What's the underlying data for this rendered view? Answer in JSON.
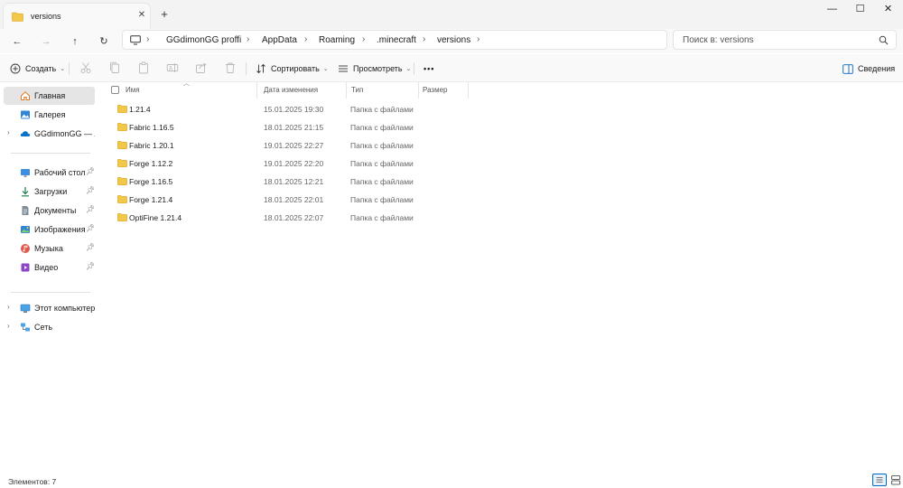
{
  "tab": {
    "title": "versions",
    "close": "✕",
    "new_tab": "+"
  },
  "window": {
    "minimize": "—",
    "maximize": "☐",
    "close": "✕"
  },
  "nav": {
    "back": "←",
    "forward": "→",
    "up": "↑",
    "refresh": "↻"
  },
  "breadcrumb": [
    "GGdimonGG proffi",
    "AppData",
    "Roaming",
    ".minecraft",
    "versions"
  ],
  "search": {
    "placeholder": "Поиск в: versions"
  },
  "toolbar": {
    "create": "Создать",
    "sort": "Сортировать",
    "view": "Просмотреть",
    "more": "•••",
    "details": "Сведения"
  },
  "sidebar": {
    "items": [
      {
        "label": "Главная",
        "icon": "home-icon"
      },
      {
        "label": "Галерея",
        "icon": "gallery-icon"
      },
      {
        "label": "GGdimonGG — Ли",
        "icon": "onedrive-icon"
      },
      {
        "label": "Рабочий стол",
        "icon": "desktop-icon"
      },
      {
        "label": "Загрузки",
        "icon": "downloads-icon"
      },
      {
        "label": "Документы",
        "icon": "documents-icon"
      },
      {
        "label": "Изображения",
        "icon": "pictures-icon"
      },
      {
        "label": "Музыка",
        "icon": "music-icon"
      },
      {
        "label": "Видео",
        "icon": "videos-icon"
      },
      {
        "label": "Этот компьютер",
        "icon": "this-pc-icon"
      },
      {
        "label": "Сеть",
        "icon": "network-icon"
      }
    ]
  },
  "columns": {
    "name": "Имя",
    "date": "Дата изменения",
    "type": "Тип",
    "size": "Размер"
  },
  "files": [
    {
      "name": "1.21.4",
      "date": "15.01.2025 19:30",
      "type": "Папка с файлами"
    },
    {
      "name": "Fabric 1.16.5",
      "date": "18.01.2025 21:15",
      "type": "Папка с файлами"
    },
    {
      "name": "Fabric 1.20.1",
      "date": "19.01.2025 22:27",
      "type": "Папка с файлами"
    },
    {
      "name": "Forge 1.12.2",
      "date": "19.01.2025 22:20",
      "type": "Папка с файлами"
    },
    {
      "name": "Forge 1.16.5",
      "date": "18.01.2025 12:21",
      "type": "Папка с файлами"
    },
    {
      "name": "Forge 1.21.4",
      "date": "18.01.2025 22:01",
      "type": "Папка с файлами"
    },
    {
      "name": "OptiFine 1.21.4",
      "date": "18.01.2025 22:07",
      "type": "Папка с файлами"
    }
  ],
  "status": {
    "items_count": "Элементов: 7"
  },
  "colors": {
    "folder": "#f3c74a",
    "selection": "#e5e5e5",
    "accent": "#0067c0"
  }
}
